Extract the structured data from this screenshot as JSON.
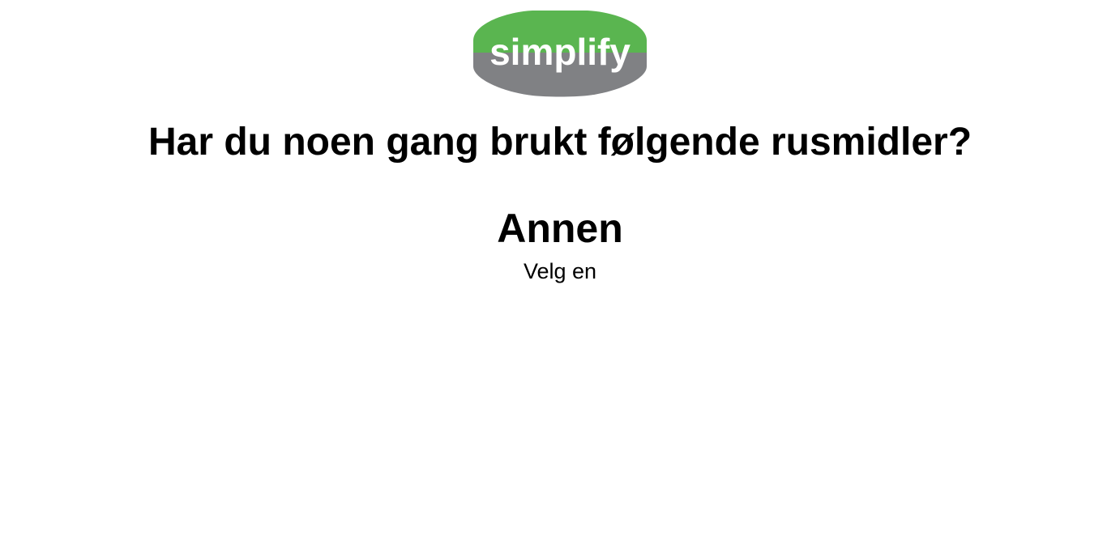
{
  "logo": {
    "text": "simplify",
    "colors": {
      "top": "#5ab550",
      "bottom": "#808184",
      "text": "#ffffff"
    }
  },
  "question": "Har du noen gang brukt følgende rusmidler?",
  "category": "Annen",
  "instruction": "Velg en"
}
